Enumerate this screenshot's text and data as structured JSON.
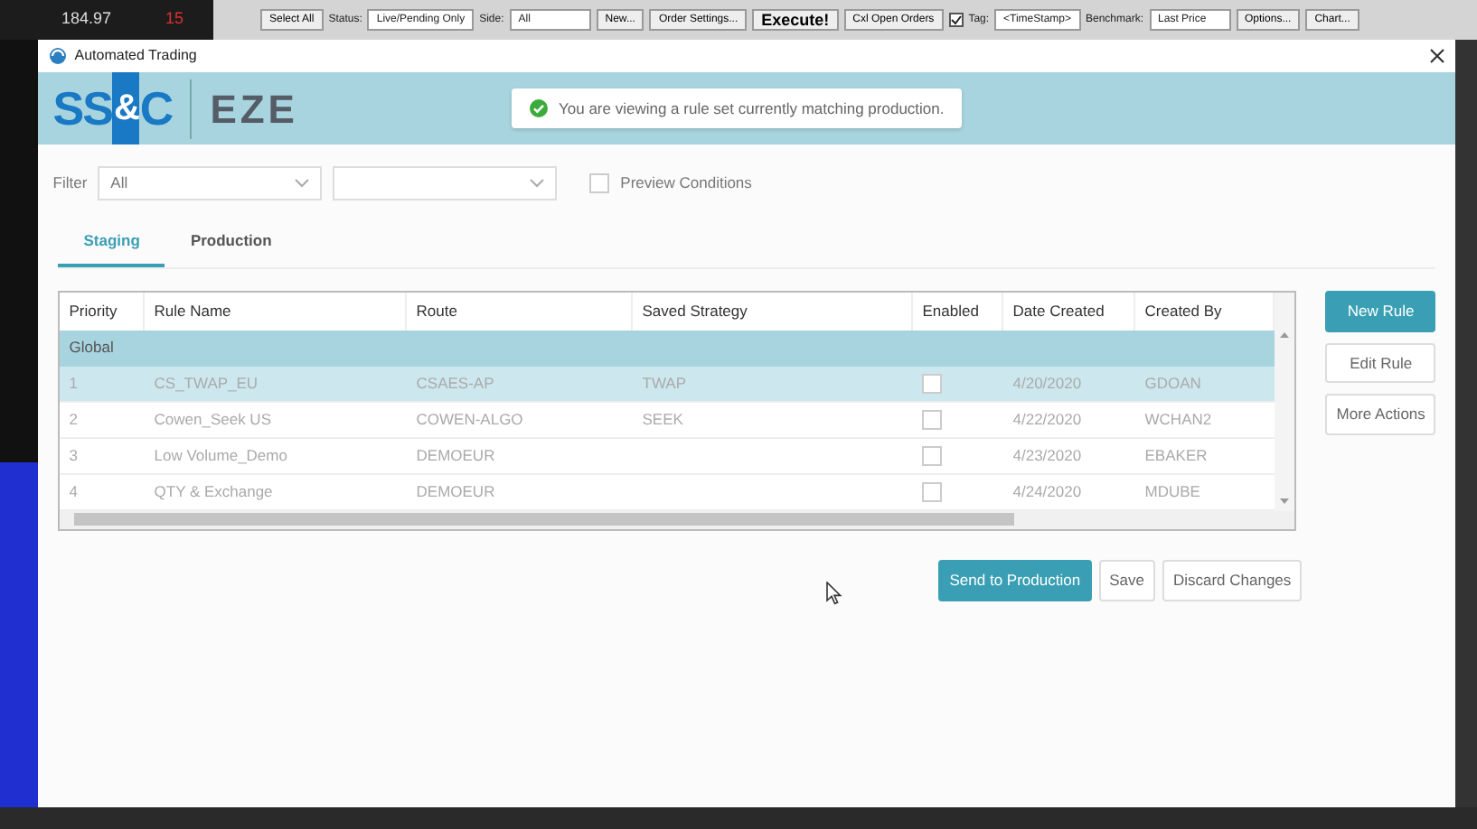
{
  "background_app": {
    "price": "184.97",
    "change": "15",
    "toolbar": [
      {
        "kind": "button",
        "label": "Select All"
      },
      {
        "kind": "label",
        "label": "Status:"
      },
      {
        "kind": "select",
        "label": "Live/Pending Only"
      },
      {
        "kind": "label",
        "label": "Side:"
      },
      {
        "kind": "select",
        "label": "All"
      },
      {
        "kind": "button",
        "label": "New..."
      },
      {
        "kind": "button",
        "label": "Order Settings..."
      },
      {
        "kind": "bold",
        "label": "Execute!"
      },
      {
        "kind": "button",
        "label": "Cxl Open Orders"
      },
      {
        "kind": "checkbox",
        "label": "Tag:",
        "checked": true
      },
      {
        "kind": "field",
        "label": "<TimeStamp>"
      },
      {
        "kind": "label",
        "label": "Benchmark:"
      },
      {
        "kind": "select",
        "label": "Last Price"
      },
      {
        "kind": "button",
        "label": "Options..."
      },
      {
        "kind": "button",
        "label": "Chart..."
      }
    ]
  },
  "window": {
    "title": "Automated Trading"
  },
  "header": {
    "logo": {
      "left": "SS",
      "amp": "&",
      "right": "C",
      "brand": "EZE"
    },
    "notice": "You are viewing a rule set currently matching production."
  },
  "filter": {
    "label": "Filter",
    "value": "All",
    "preview": {
      "label": "Preview Conditions",
      "checked": false
    }
  },
  "tabs": [
    {
      "label": "Staging",
      "selected": true
    },
    {
      "label": "Production",
      "selected": false
    }
  ],
  "table": {
    "columns": [
      "Priority",
      "Rule Name",
      "Route",
      "Saved Strategy",
      "Enabled",
      "Date Created",
      "Created By"
    ],
    "group": "Global",
    "rows": [
      {
        "priority": "1",
        "rule_name": "CS_TWAP_EU",
        "route": "CSAES-AP",
        "saved_strategy": "TWAP",
        "enabled": false,
        "date_created": "4/20/2020",
        "created_by": "GDOAN",
        "selected": true
      },
      {
        "priority": "2",
        "rule_name": "Cowen_Seek US",
        "route": "COWEN-ALGO",
        "saved_strategy": "SEEK",
        "enabled": false,
        "date_created": "4/22/2020",
        "created_by": "WCHAN2",
        "selected": false
      },
      {
        "priority": "3",
        "rule_name": "Low Volume_Demo",
        "route": "DEMOEUR",
        "enabled": false,
        "date_created": "4/23/2020",
        "created_by": "EBAKER",
        "selected": false
      },
      {
        "priority": "4",
        "rule_name": "QTY & Exchange",
        "route": "DEMOEUR",
        "enabled": false,
        "date_created": "4/24/2020",
        "created_by": "MDUBE",
        "selected": false
      }
    ]
  },
  "side_buttons": [
    {
      "label": "New Rule",
      "primary": true
    },
    {
      "label": "Edit Rule",
      "primary": false
    },
    {
      "label": "More Actions",
      "primary": false
    }
  ],
  "footer_buttons": [
    {
      "label": "Send to Production",
      "primary": true
    },
    {
      "label": "Save",
      "primary": false
    },
    {
      "label": "Discard Changes",
      "primary": false
    }
  ]
}
